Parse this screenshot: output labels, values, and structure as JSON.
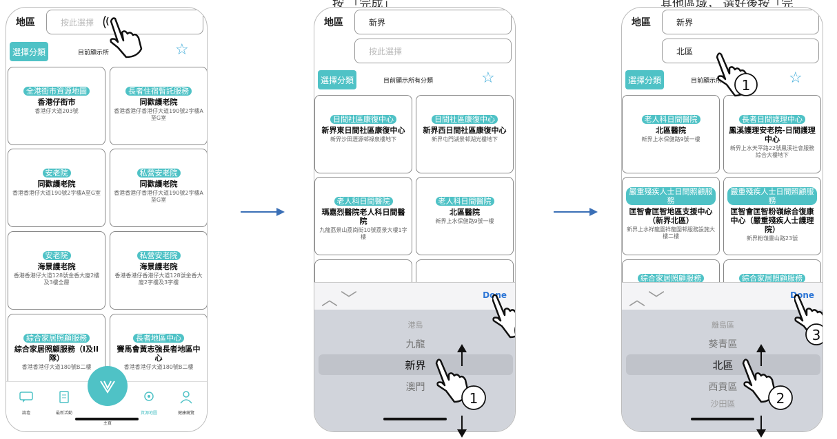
{
  "captions": {
    "middle": "按 「完成」",
    "right": "其他區域， 選好後按「完"
  },
  "screens": [
    {
      "region_label": "地區",
      "region_placeholder": "按此選擇",
      "category_button": "選擇分類",
      "show_all": "目前顯示所",
      "cards": [
        {
          "tag": "全港街市資源地圖",
          "title": "香港仔街市",
          "address": "香港仔大道203號"
        },
        {
          "tag": "長者住宿暫託服務",
          "title": "同歡護老院",
          "address": "香港香港仔香港仔大道190號2字樓A至G室"
        },
        {
          "tag": "安老院",
          "title": "同歡護老院",
          "address": "香港香港仔大道190號2字樓A至G室"
        },
        {
          "tag": "私營安老院",
          "title": "同歡護老院",
          "address": "香港香港仔香港仔大道190號2字樓A至G室"
        },
        {
          "tag": "安老院",
          "title": "海景護老院",
          "address": "香港香港仔大道128號金香大廈2樓及3樓全層"
        },
        {
          "tag": "私營安老院",
          "title": "海景護老院",
          "address": "香港香港仔香港仔大道128號金香大廈2字樓及3字樓"
        },
        {
          "tag": "綜合家居照顧服務",
          "title": "綜合家居照顧服務（I及II隊）",
          "address": "香港香港仔大道180號B二樓"
        },
        {
          "tag": "長者地區中心",
          "title": "賽馬會黃志強長者地區中心",
          "address": "香港香港仔大道180號B二樓"
        }
      ],
      "tabs": [
        "論壇",
        "最新活動",
        "主頁",
        "資源地圖",
        "健康鏡覽"
      ]
    },
    {
      "region_label": "地區",
      "region_value": "新界",
      "district_placeholder": "按此選擇",
      "category_button": "選擇分類",
      "show_all": "目前顯示所有分類",
      "cards": [
        {
          "tag": "日間社區康復中心",
          "title": "新界東日間社區康復中心",
          "address": "新界沙田瀝源邨祿泉樓地下"
        },
        {
          "tag": "日間社區康復中心",
          "title": "新界西日間社區康復中心",
          "address": "新界屯門湖景邨湖光樓地下"
        },
        {
          "tag": "老人科日間醫院",
          "title": "瑪嘉烈醫院老人科日間醫院",
          "address": "九龍荔景山荔崗街10號荔景大樓1字樓"
        },
        {
          "tag": "老人科日間醫院",
          "title": "北區醫院",
          "address": "新界上水保健路9號一樓"
        }
      ],
      "done": "Done",
      "picker": [
        "港島",
        "九龍",
        "新界",
        "澳門"
      ]
    },
    {
      "region_label": "地區",
      "region_value": "新界",
      "district_value": "北區",
      "category_button": "選擇分類",
      "show_all": "目前顯示所",
      "cards": [
        {
          "tag": "老人科日間醫院",
          "title": "北區醫院",
          "address": "新界上水保健路9號一樓"
        },
        {
          "tag": "長者日間護理中心",
          "title": "鳳溪護理安老院-日間護理中心",
          "address": "新界上水天平路22號鳳溪社會服務綜合大樓地下"
        },
        {
          "tag": "嚴重殘疾人士日間照顧服務",
          "title": "匡智會匡智地區支援中心（新界北區）",
          "address": "新界上水祥龍圍祥龍圍邨服務設施大樓二樓"
        },
        {
          "tag": "嚴重殘疾人士日間照顧服務",
          "title": "匡智會匡智粉嶺綜合復康中心（嚴重殘疾人士護理院）",
          "address": "新界粉嶺靈山路23號"
        },
        {
          "tag": "綜合家居照顧服務"
        },
        {
          "tag": "綜合家居照顧服務"
        }
      ],
      "done": "Done",
      "picker": [
        "離島區",
        "葵青區",
        "北區",
        "西貢區",
        "沙田區"
      ]
    }
  ],
  "step_numbers": [
    "1",
    "2",
    "1",
    "2",
    "3"
  ],
  "colors": {
    "accent": "#4fc2c6",
    "star": "#39a9d8",
    "done": "#2d76d6"
  }
}
